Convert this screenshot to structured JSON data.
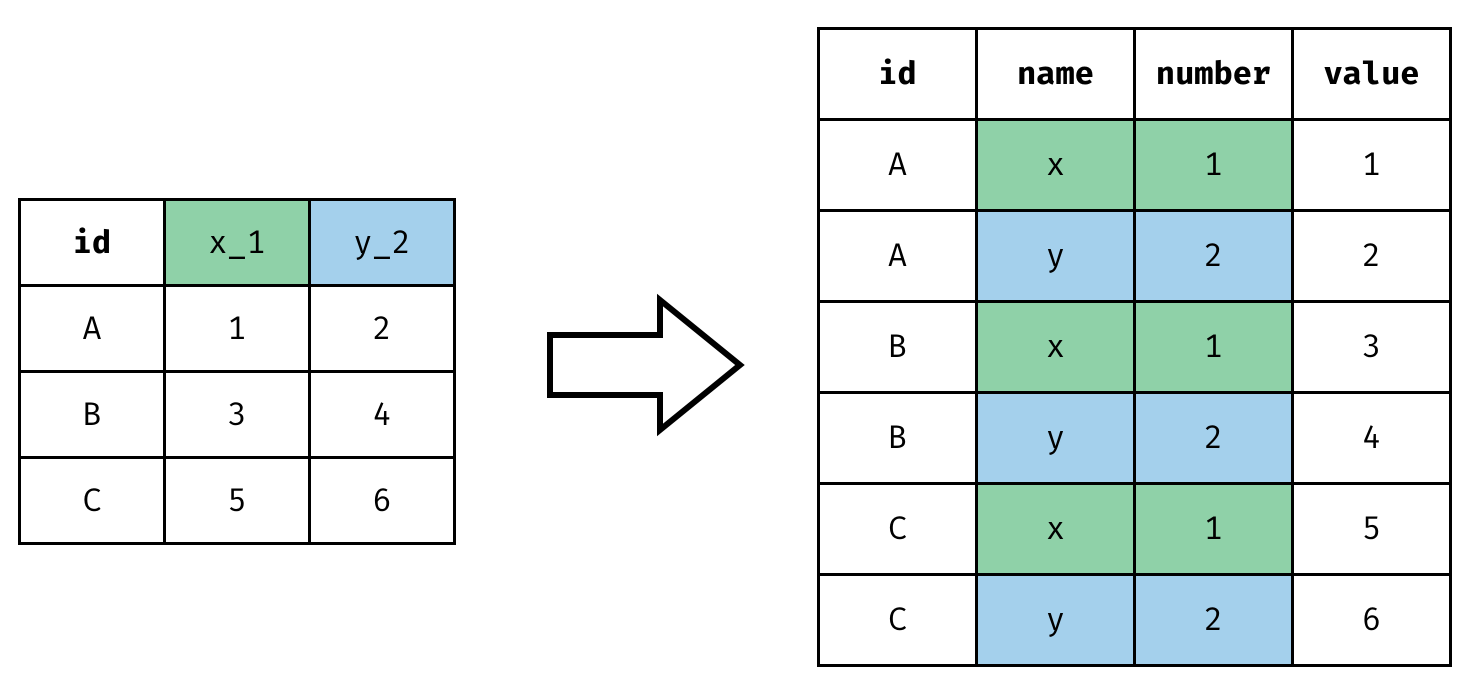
{
  "colors": {
    "green": "#8fd1a8",
    "blue": "#a4d0ec"
  },
  "left_table": {
    "headers": {
      "id": "id",
      "x_1": "x_1",
      "y_2": "y_2"
    },
    "rows": [
      {
        "id": "A",
        "x_1": "1",
        "y_2": "2"
      },
      {
        "id": "B",
        "x_1": "3",
        "y_2": "4"
      },
      {
        "id": "C",
        "x_1": "5",
        "y_2": "6"
      }
    ]
  },
  "right_table": {
    "headers": {
      "id": "id",
      "name": "name",
      "number": "number",
      "value": "value"
    },
    "rows": [
      {
        "id": "A",
        "name": "x",
        "number": "1",
        "value": "1",
        "fill": "x"
      },
      {
        "id": "A",
        "name": "y",
        "number": "2",
        "value": "2",
        "fill": "y"
      },
      {
        "id": "B",
        "name": "x",
        "number": "1",
        "value": "3",
        "fill": "x"
      },
      {
        "id": "B",
        "name": "y",
        "number": "2",
        "value": "4",
        "fill": "y"
      },
      {
        "id": "C",
        "name": "x",
        "number": "1",
        "value": "5",
        "fill": "x"
      },
      {
        "id": "C",
        "name": "y",
        "number": "2",
        "value": "6",
        "fill": "y"
      }
    ]
  },
  "arrow": {
    "icon": "right-block-arrow"
  }
}
